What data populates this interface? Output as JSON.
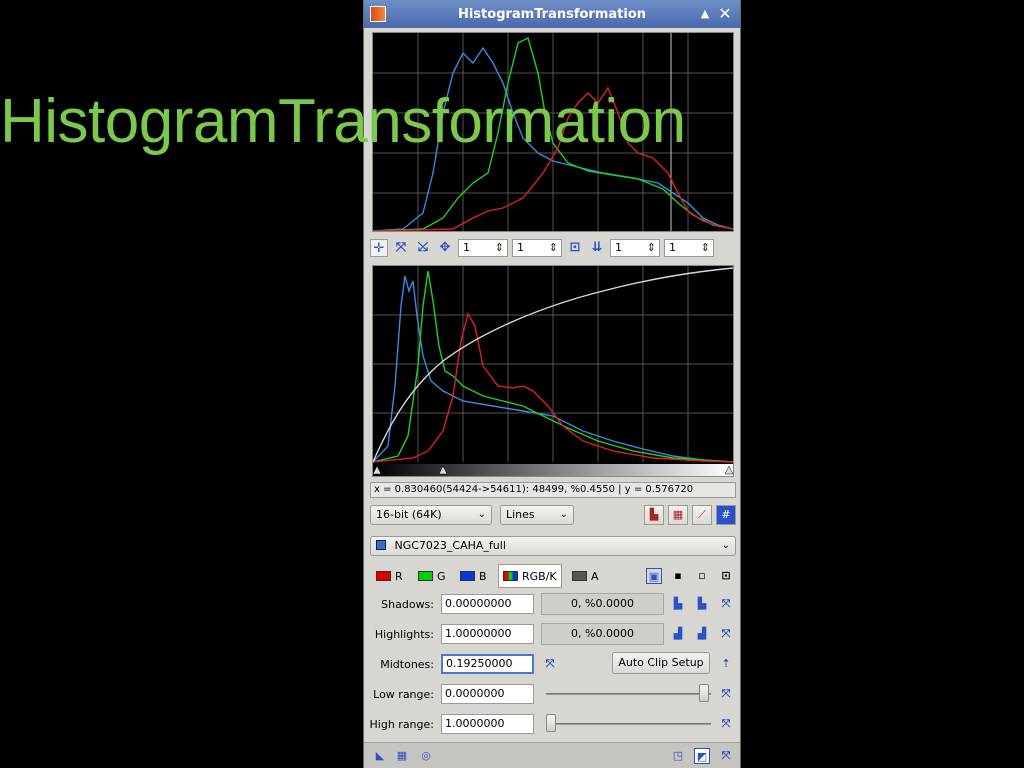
{
  "overlay": {
    "title": "HistogramTransformation"
  },
  "window": {
    "title": "HistogramTransformation",
    "icons": {
      "app": "histogram-app-icon",
      "shade": "shade-icon",
      "close": "close-icon"
    }
  },
  "graph_toolbar": {
    "tools": [
      "pan-cursor-icon",
      "zoom-fit-icon",
      "zoom-in-icon",
      "move-icon"
    ],
    "zoom_h1": "1",
    "zoom_v1": "1",
    "zoom_h2": "1",
    "zoom_v2": "1",
    "mid_tools": [
      "one-to-one-icon",
      "store-down-icon"
    ]
  },
  "status_readout": "x = 0.830460(54424->54611): 48499, %0.4550 | y = 0.576720",
  "resolution": {
    "selected": "16-bit (64K)"
  },
  "plot_mode": {
    "selected": "Lines"
  },
  "view": {
    "selected": "NGC7023_CAHA_full"
  },
  "channels": [
    {
      "label": "R",
      "color": "#e00000"
    },
    {
      "label": "G",
      "color": "#00d000"
    },
    {
      "label": "B",
      "color": "#1030e0"
    },
    {
      "label": "RGB/K",
      "color": "#ffffff"
    },
    {
      "label": "A",
      "color": "#555555"
    }
  ],
  "params": {
    "shadows": {
      "label": "Shadows:",
      "value": "0.00000000",
      "readout": "0, %0.0000"
    },
    "highlights": {
      "label": "Highlights:",
      "value": "1.00000000",
      "readout": "0, %0.0000"
    },
    "midtones": {
      "label": "Midtones:",
      "value": "0.19250000"
    },
    "low_range": {
      "label": "Low range:",
      "value": "0.0000000",
      "level": 0.99
    },
    "high_range": {
      "label": "High range:",
      "value": "1.0000000",
      "level": 0.0
    }
  },
  "auto_clip": {
    "label": "Auto Clip Setup"
  },
  "colors": {
    "red": "#ff2020",
    "green": "#20e020",
    "blue": "#3a8be0",
    "curve": "#d8d8d8",
    "grid": "#555555"
  }
}
